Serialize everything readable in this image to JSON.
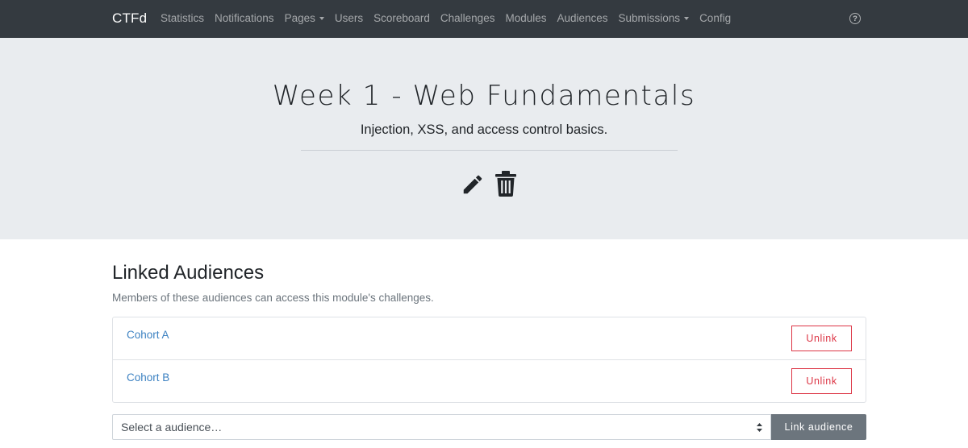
{
  "navbar": {
    "brand": "CTFd",
    "items": [
      {
        "label": "Statistics",
        "dropdown": false
      },
      {
        "label": "Notifications",
        "dropdown": false
      },
      {
        "label": "Pages",
        "dropdown": true
      },
      {
        "label": "Users",
        "dropdown": false
      },
      {
        "label": "Scoreboard",
        "dropdown": false
      },
      {
        "label": "Challenges",
        "dropdown": false
      },
      {
        "label": "Modules",
        "dropdown": false
      },
      {
        "label": "Audiences",
        "dropdown": false
      },
      {
        "label": "Submissions",
        "dropdown": true
      },
      {
        "label": "Config",
        "dropdown": false
      }
    ],
    "help_icon": "question-circle-icon",
    "help_glyph": "?"
  },
  "jumbotron": {
    "title": "Week 1 - Web Fundamentals",
    "subtitle": "Injection, XSS, and access control basics.",
    "edit_icon": "pencil-icon",
    "delete_icon": "trash-icon"
  },
  "audiences": {
    "title": "Linked Audiences",
    "description": "Members of these audiences can access this module's challenges.",
    "rows": [
      {
        "name": "Cohort A",
        "action": "Unlink"
      },
      {
        "name": "Cohort B",
        "action": "Unlink"
      }
    ],
    "select_placeholder": "Select a audience…",
    "link_button": "Link audience"
  },
  "colors": {
    "navbar_bg": "#343a40",
    "jumbotron_bg": "#e9ecef",
    "link": "#3d82c2",
    "danger": "#dc3545",
    "secondary": "#6c757d"
  }
}
